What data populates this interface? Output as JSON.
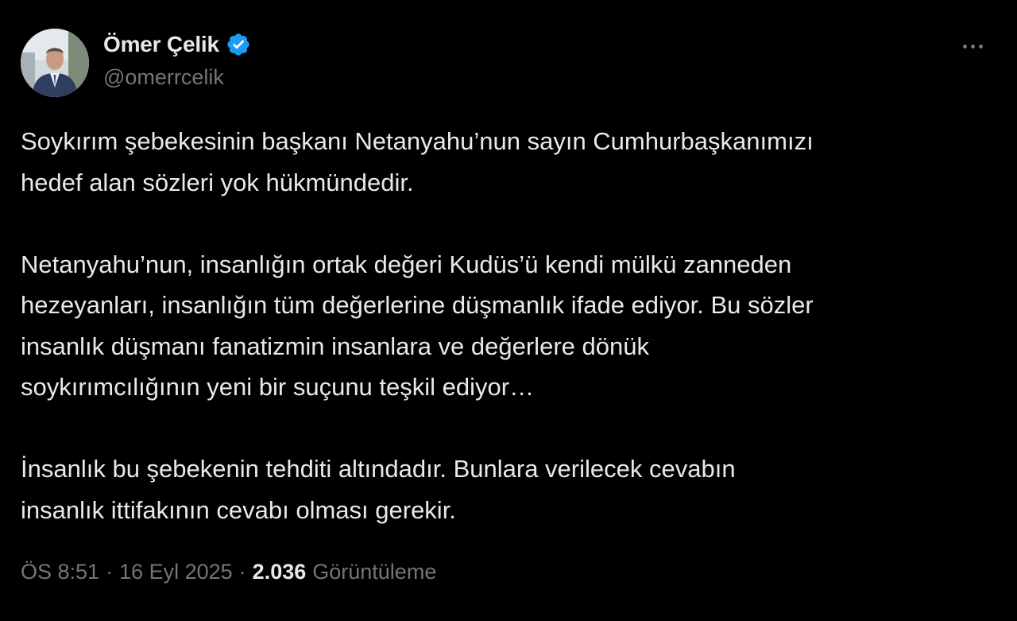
{
  "author": {
    "display_name": "Ömer Çelik",
    "handle": "@omerrcelik",
    "verified_color": "#1d9bf0"
  },
  "tweet": {
    "paragraphs": [
      "Soykırım şebekesinin başkanı  Netanyahu’nun sayın Cumhurbaşkanımızı\nhedef alan sözleri yok hükmündedir.",
      "Netanyahu’nun, insanlığın ortak değeri Kudüs’ü kendi mülkü zanneden\nhezeyanları, insanlığın tüm değerlerine düşmanlık ifade ediyor. Bu sözler\ninsanlık düşmanı fanatizmin insanlara ve değerlere dönük\nsoykırımcılığının yeni bir suçunu teşkil ediyor…",
      "İnsanlık bu şebekenin tehditi altındadır. Bunlara verilecek cevabın\ninsanlık ittifakının cevabı olması gerekir."
    ]
  },
  "meta": {
    "time": "ÖS 8:51",
    "separator": "·",
    "date": "16 Eyl 2025",
    "views_count": "2.036",
    "views_label": "Görüntüleme"
  },
  "icons": {
    "more": "more-horizontal-icon",
    "verified": "verified-badge-icon"
  },
  "colors": {
    "background": "#000000",
    "text_primary": "#e7e9ea",
    "text_secondary": "#71767b",
    "accent": "#1d9bf0"
  }
}
